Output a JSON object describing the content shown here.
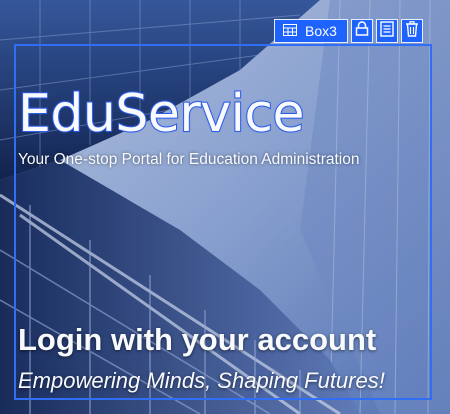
{
  "hero": {
    "brand": "EduService",
    "tagline": "Your One-stop Portal for Education Administration",
    "login_title": "Login with your account",
    "subtitle": "Empowering Minds, Shaping Futures!"
  },
  "editor": {
    "component_label": "Box3",
    "icons": [
      "table-icon",
      "lock-icon",
      "properties-icon",
      "trash-icon"
    ]
  },
  "colors": {
    "accent": "#1f63ff",
    "selection": "#2f6ef5",
    "sky": "#9fb9e6",
    "glass": "#1c2f5e"
  }
}
